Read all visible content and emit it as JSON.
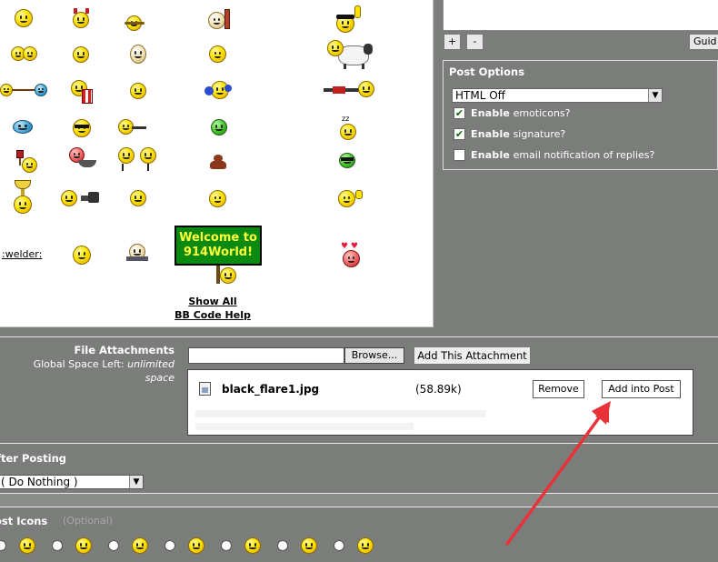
{
  "smilies_panel": {
    "welder_link": ":welder:",
    "welcome_sign": "Welcome to 914World!",
    "show_all": "Show All",
    "bbcode_help": "BB Code Help"
  },
  "toolbar": {
    "plus_label": "+",
    "minus_label": "-",
    "guide_label": "Guid"
  },
  "post_options": {
    "title": "Post Options",
    "html_select_value": "HTML Off",
    "options": [
      {
        "bold": "Enable",
        "rest": "emoticons?",
        "checked": true
      },
      {
        "bold": "Enable",
        "rest": "signature?",
        "checked": true
      },
      {
        "bold": "Enable",
        "rest": "email notification of replies?",
        "checked": false
      }
    ]
  },
  "attachments": {
    "label": "File Attachments",
    "space_left_label": "Global Space Left:",
    "space_left_value": "unlimited space",
    "browse_label": "Browse...",
    "add_attachment_label": "Add This Attachment",
    "file": {
      "name": "black_flare1.jpg",
      "size": "(58.89k)",
      "remove_label": "Remove",
      "add_into_post_label": "Add into Post"
    }
  },
  "after_posting": {
    "label": "fter Posting",
    "select_value": "( Do Nothing )"
  },
  "post_icons": {
    "label": "ost Icons",
    "optional_text": "(Optional)"
  },
  "colors": {
    "page_bg": "#7b7d7b",
    "welcome_sign_bg": "#0b8a12",
    "welcome_sign_text": "#ffff3a",
    "annotation_arrow": "#e8323a"
  }
}
